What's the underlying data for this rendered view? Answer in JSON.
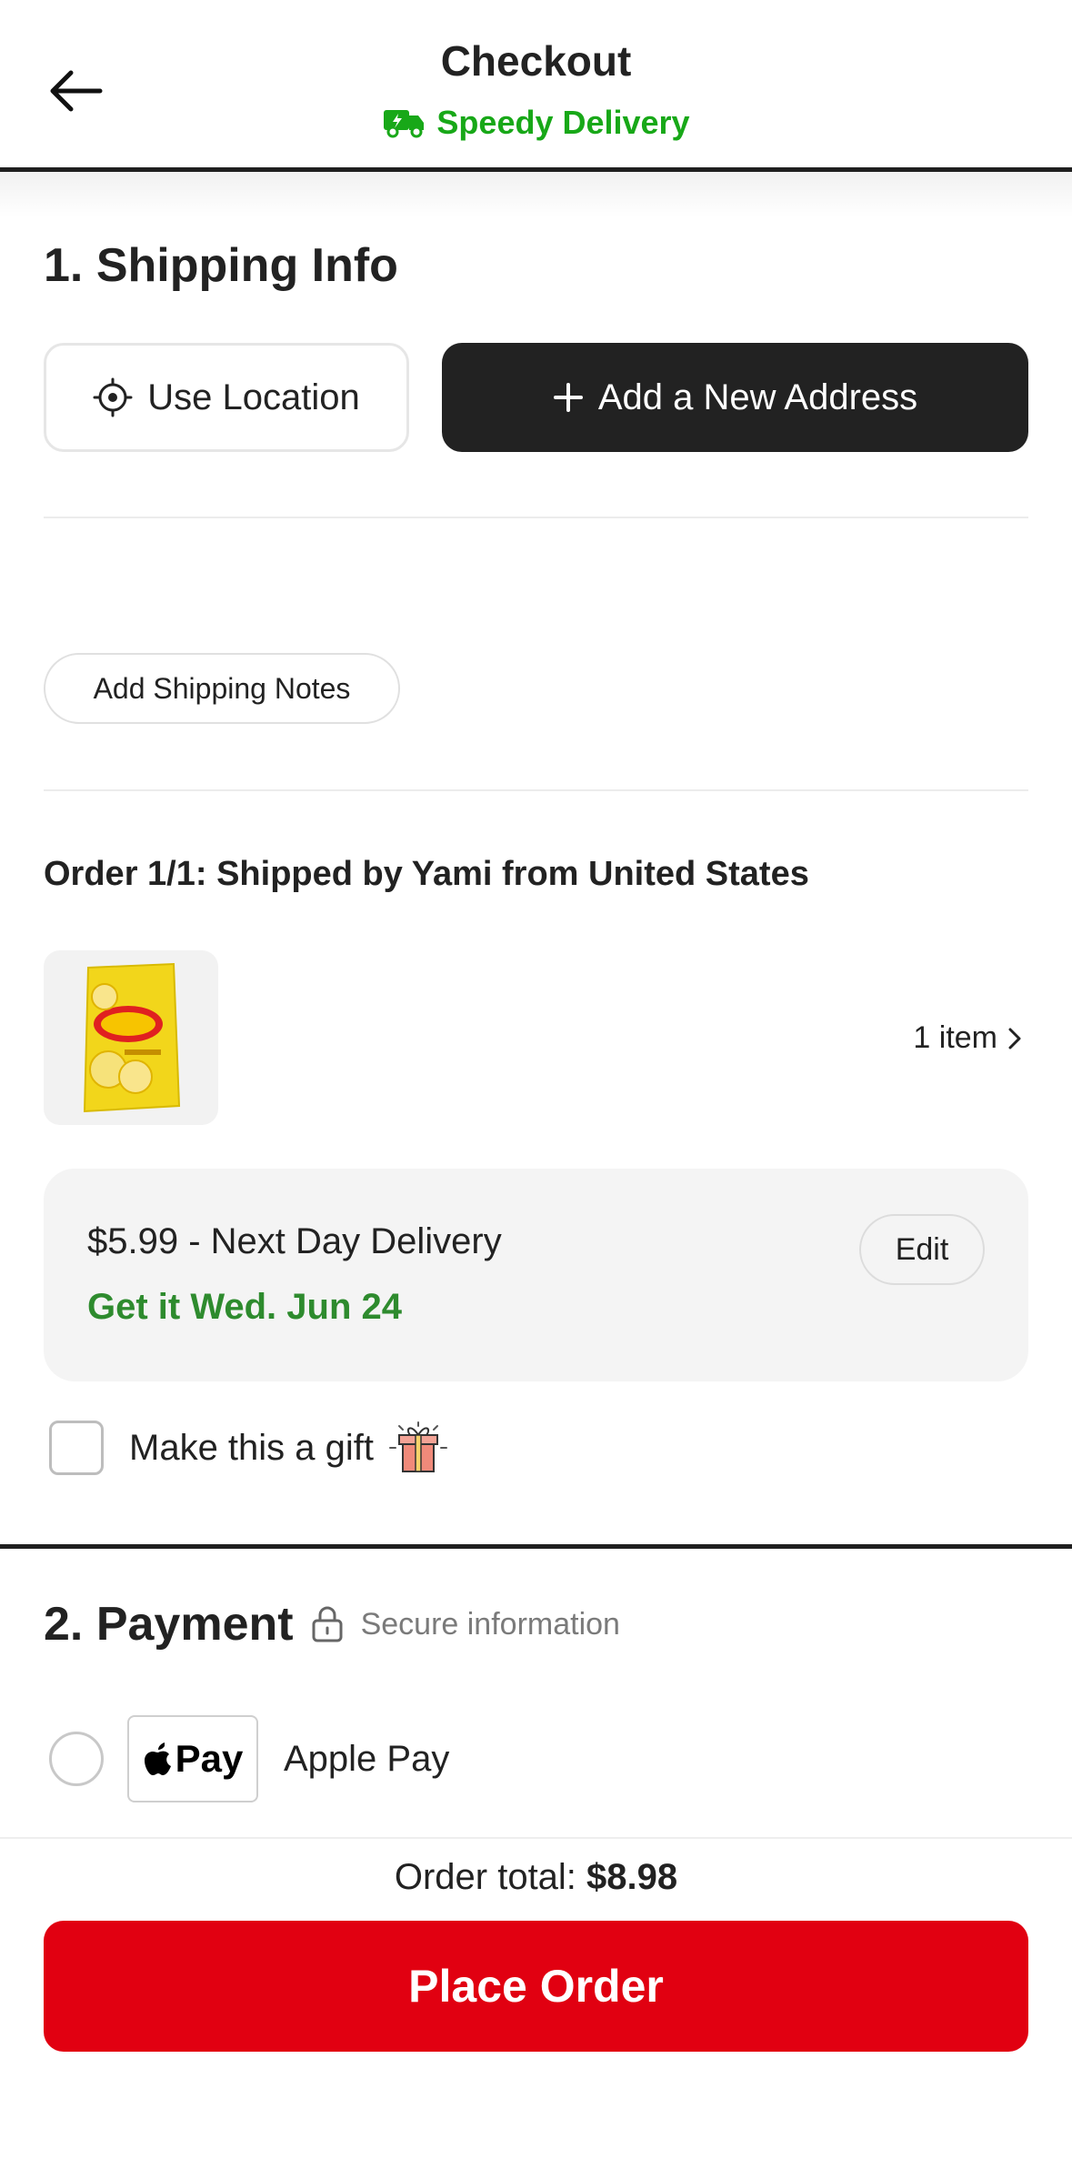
{
  "header": {
    "title": "Checkout",
    "subtitle": "Speedy Delivery",
    "back_icon": "arrow-left-icon",
    "truck_icon": "delivery-truck-icon",
    "accent_color": "#18a818"
  },
  "shipping": {
    "title": "1. Shipping Info",
    "use_location_label": "Use Location",
    "add_address_label": "Add a New Address",
    "add_notes_label": "Add Shipping Notes"
  },
  "order": {
    "heading": "Order 1/1: Shipped by Yami from United States",
    "item_count_label": "1 item",
    "product_image_icon": "potato-chips-bag",
    "delivery_price_label": "$5.99 - Next Day Delivery",
    "delivery_date_label": "Get it Wed. Jun 24",
    "edit_label": "Edit",
    "gift_label": "Make this a gift",
    "gift_icon": "gift-icon"
  },
  "payment": {
    "title": "2. Payment",
    "secure_label": "Secure information",
    "apple_pay_badge": "Pay",
    "apple_pay_label": "Apple Pay"
  },
  "footer": {
    "order_total_label": "Order total:",
    "order_total_value": "$8.98",
    "place_order_label": "Place Order",
    "primary_color": "#e10011"
  }
}
